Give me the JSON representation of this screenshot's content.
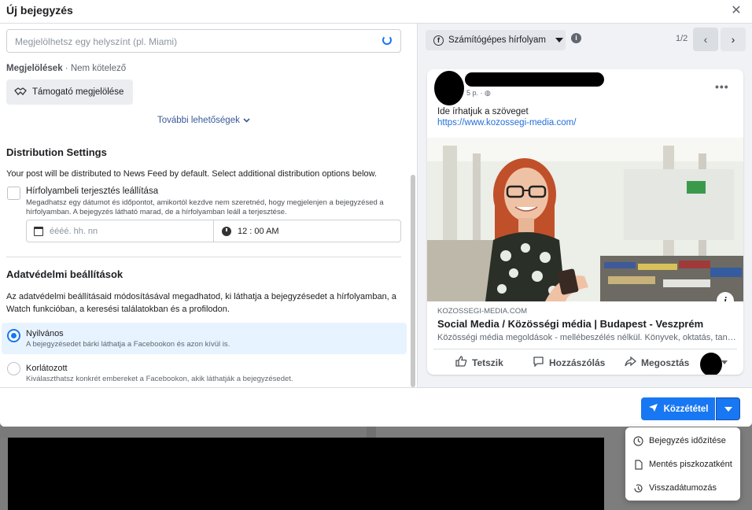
{
  "modal": {
    "title": "Új bejegyzés"
  },
  "left": {
    "location_placeholder": "Megjelölhetsz egy helyszínt (pl. Miami)",
    "tags_label": "Megjelölések",
    "tags_optional": " · Nem kötelező",
    "sponsor_button": "Támogató megjelölése",
    "more_options": "További lehetőségek",
    "distribution": {
      "title": "Distribution Settings",
      "description": "Your post will be distributed to News Feed by default. Select additional distribution options below.",
      "feed_stop_title": "Hírfolyambeli terjesztés leállítása",
      "feed_stop_description": "Megadhatsz egy dátumot és időpontot, amikortól kezdve nem szeretnéd, hogy megjelenjen a bejegyzésed a hírfolyamban. A bejegyzés látható marad, de a hírfolyamban leáll a terjesztése.",
      "date_placeholder": "éééé. hh. nn",
      "time_value": "12 : 00 AM",
      "feed_stop_checked": false
    },
    "privacy": {
      "title": "Adatvédelmi beállítások",
      "description": "Az adatvédelmi beállításaid módosításával megadhatod, ki láthatja a bejegyzésedet a hírfolyamban, a Watch funkcióban, a keresési találatokban és a profilodon.",
      "options": [
        {
          "title": "Nyilvános",
          "description": "A bejegyzésedet bárki láthatja a Facebookon és azon kívül is.",
          "selected": true
        },
        {
          "title": "Korlátozott",
          "description": "Kiválaszthatsz konkrét embereket a Facebookon, akik láthatják a bejegyzésedet.",
          "selected": false
        }
      ]
    }
  },
  "preview": {
    "feed_select": "Számítógépes hírfolyam",
    "page_count": "1/2",
    "post": {
      "time": "5 p. ·",
      "text": "Ide írhatjuk a szöveget",
      "link": "https://www.kozossegi-media.com/",
      "link_domain": "KOZOSSEGI-MEDIA.COM",
      "link_title": "Social Media / Közösségi média | Budapest - Veszprém",
      "link_description": "Közösségi média megoldások - mellébeszélés nélkül. Könyvek, oktatás, tanácsadás",
      "actions": {
        "like": "Tetszik",
        "comment": "Hozzászólás",
        "share": "Megosztás"
      }
    }
  },
  "footer": {
    "publish_button": "Közzététel",
    "menu": [
      "Bejegyzés időzítése",
      "Mentés piszkozatként",
      "Visszadátumozás"
    ]
  },
  "colors": {
    "accent": "#1877f2",
    "selected_bg": "#e7f3ff",
    "link": "#216fdb"
  },
  "icons": [
    "close-icon",
    "spinner-icon",
    "handshake-icon",
    "chevron-down-icon",
    "calendar-icon",
    "clock-icon",
    "facebook-icon",
    "info-icon",
    "chevron-left-icon",
    "chevron-right-icon",
    "more-icon",
    "like-icon",
    "comment-icon",
    "share-icon",
    "send-icon",
    "schedule-icon",
    "draft-icon",
    "backdate-icon"
  ]
}
